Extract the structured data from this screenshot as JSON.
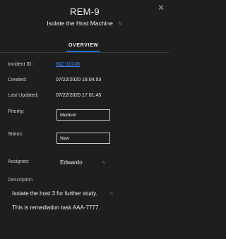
{
  "header": {
    "id": "REM-9",
    "title": "Isolate the Host Machine"
  },
  "tabs": [
    {
      "label": "OVERVIEW",
      "selected": true
    }
  ],
  "fields": {
    "incident_id": {
      "label": "Incident ID:",
      "value": "INC-10248"
    },
    "created": {
      "label": "Created:",
      "value": "07/22/2020 16:04:53"
    },
    "last_updated": {
      "label": "Last Updated:",
      "value": "07/22/2020 17:01:45"
    },
    "priority": {
      "label": "Priority:",
      "value": "Medium"
    },
    "status": {
      "label": "Status:",
      "value": "New"
    },
    "assignee": {
      "label": "Assignee:",
      "value": "Edwardo"
    }
  },
  "description": {
    "label": "Description",
    "lines": [
      "Isolate the host 3 for further study.",
      "This is remediation task AAA-7777."
    ]
  },
  "icons": {
    "close": "close-icon",
    "edit": "pencil-icon"
  },
  "colors": {
    "background": "#1e1e1e",
    "accent": "#1f6fd0",
    "link": "#3d8bff"
  }
}
